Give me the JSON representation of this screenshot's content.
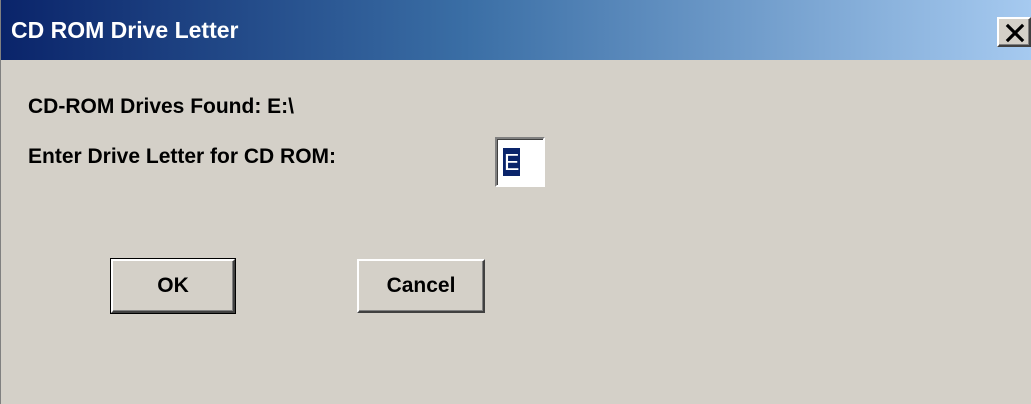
{
  "window": {
    "title": "CD ROM Drive Letter",
    "close_icon": "close-icon"
  },
  "dialog": {
    "drives_found_label": "CD-ROM Drives Found: E:\\",
    "drive_letter_label": "Enter Drive Letter for CD ROM:",
    "drive_letter_value": "E",
    "ok_label": "OK",
    "cancel_label": "Cancel"
  },
  "colors": {
    "titlebar_start": "#0a246a",
    "titlebar_end": "#a6caf0",
    "face": "#d4d0c8",
    "selection": "#0a246a"
  }
}
